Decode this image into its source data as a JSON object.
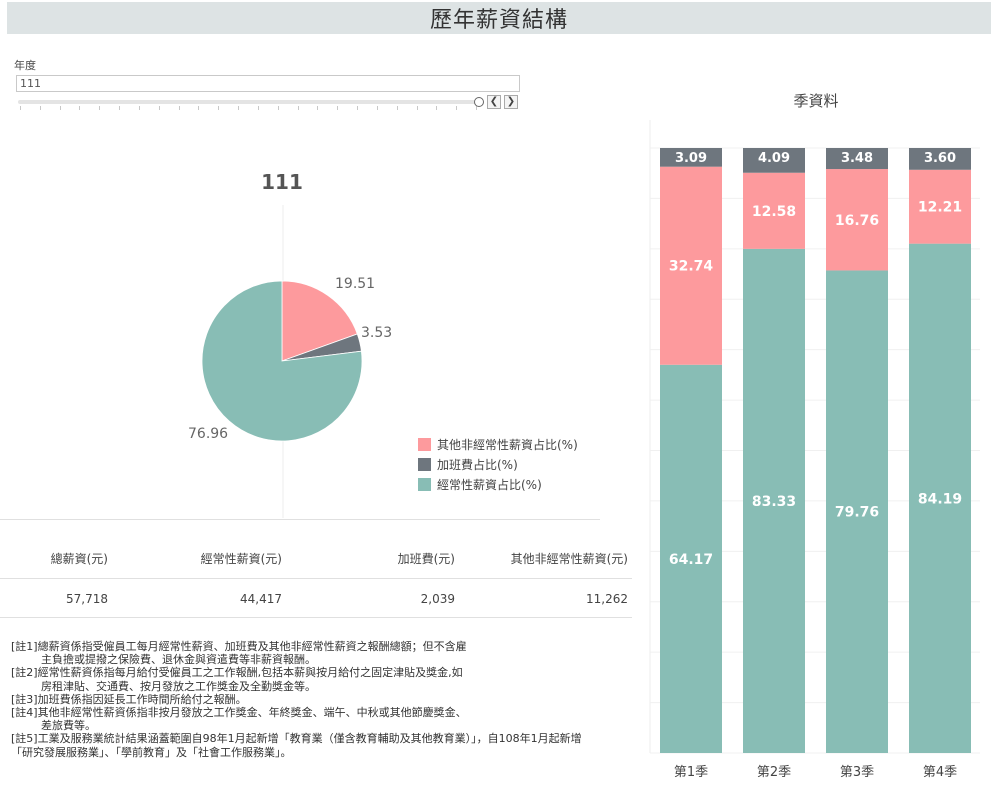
{
  "header": {
    "title": "歷年薪資結構"
  },
  "year_filter": {
    "label": "年度",
    "value": "111",
    "prev_icon": "chevron-left",
    "next_icon": "chevron-right"
  },
  "pie": {
    "title": "111",
    "chart_data": {
      "type": "pie",
      "labels": [
        "其他非經常性薪資占比(%)",
        "加班費占比(%)",
        "經常性薪資占比(%)"
      ],
      "values": [
        19.51,
        3.53,
        76.96
      ],
      "value_labels": [
        "19.51",
        "3.53",
        "76.96"
      ],
      "colors": [
        "#fd9a9d",
        "#6e767e",
        "#88bdb5"
      ]
    },
    "legend": [
      {
        "label": "其他非經常性薪資占比(%)",
        "color": "#fd9a9d"
      },
      {
        "label": "加班費占比(%)",
        "color": "#6e767e"
      },
      {
        "label": "經常性薪資占比(%)",
        "color": "#88bdb5"
      }
    ]
  },
  "summary_table": {
    "headers": [
      "總薪資(元)",
      "經常性薪資(元)",
      "加班費(元)",
      "其他非經常性薪資(元)"
    ],
    "values": [
      "57,718",
      "44,417",
      "2,039",
      "11,262"
    ]
  },
  "notes": [
    {
      "text": "[註1]總薪資係指受僱員工每月經常性薪資、加班費及其他非經常性薪資之報酬總額；但不含雇",
      "indent": false
    },
    {
      "text": "主負擔或提撥之保險費、退休金與資遣費等非薪資報酬。",
      "indent": true
    },
    {
      "text": "[註2]經常性薪資係指每月給付受僱員工之工作報酬,包括本薪與按月給付之固定津貼及獎金,如",
      "indent": false
    },
    {
      "text": "房租津貼、交通費、按月發放之工作獎金及全勤獎金等。",
      "indent": true
    },
    {
      "text": "[註3]加班費係指因延長工作時間所給付之報酬。",
      "indent": false
    },
    {
      "text": "[註4]其他非經常性薪資係指非按月發放之工作獎金、年終獎金、端午、中秋或其他節慶獎金、",
      "indent": false
    },
    {
      "text": "差旅費等。",
      "indent": true
    },
    {
      "text": "[註5]工業及服務業統計結果涵蓋範圍自98年1月起新增「教育業（僅含教育輔助及其他教育業）」，自108年1月起新增",
      "indent": false
    },
    {
      "text": "「研究發展服務業」、「學前教育」及「社會工作服務業」。",
      "indent": false
    }
  ],
  "quarter_chart": {
    "title": "季資料",
    "chart_data": {
      "type": "bar",
      "stacked": true,
      "categories": [
        "第1季",
        "第2季",
        "第3季",
        "第4季"
      ],
      "series": [
        {
          "name": "經常性薪資占比(%)",
          "values": [
            64.17,
            83.33,
            79.76,
            84.19
          ],
          "labels": [
            "64.17",
            "83.33",
            "79.76",
            "84.19"
          ],
          "color": "#88bdb5"
        },
        {
          "name": "其他非經常性薪資占比(%)",
          "values": [
            32.74,
            12.58,
            16.76,
            12.21
          ],
          "labels": [
            "32.74",
            "12.58",
            "16.76",
            "12.21"
          ],
          "color": "#fd9a9d"
        },
        {
          "name": "加班費占比(%)",
          "values": [
            3.09,
            4.09,
            3.48,
            3.6
          ],
          "labels": [
            "3.09",
            "4.09",
            "3.48",
            "3.60"
          ],
          "color": "#6e767e"
        }
      ],
      "ylim": [
        0,
        100
      ],
      "grid": true
    }
  }
}
